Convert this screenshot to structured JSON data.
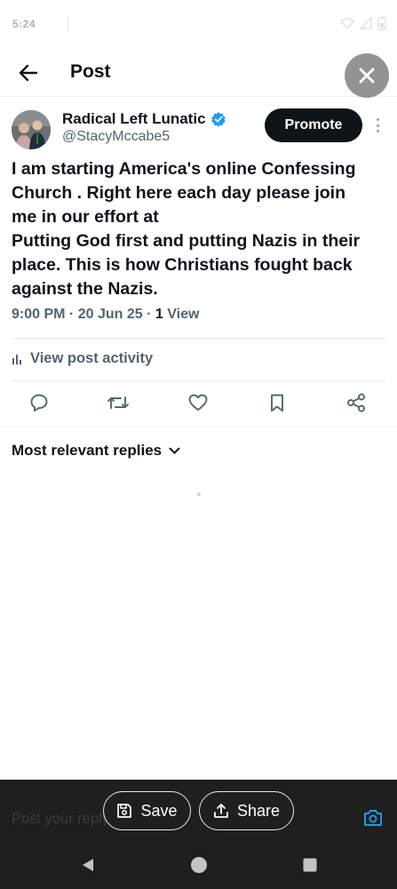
{
  "status_bar": {
    "time": "5:24",
    "icons": [
      "wifi-icon",
      "signal-icon",
      "battery-icon"
    ]
  },
  "header": {
    "title": "Post",
    "back_icon": "arrow-left-icon"
  },
  "overlay": {
    "close_icon": "close-icon"
  },
  "post": {
    "author_name": "Radical Left Lunatic",
    "verified_icon": "verified-badge-icon",
    "handle": "@StacyMccabe5",
    "promote_label": "Promote",
    "text_lines": [
      "I am starting America's online Confessing",
      "Church . Right here each day please join",
      "me in our effort at",
      "Putting God first and putting Nazis in their",
      "place. This is how Christians fought back",
      "against the Nazis."
    ],
    "time": "9:00 PM",
    "date": "20 Jun 25",
    "views_count": "1",
    "views_label": "View",
    "separator": "·"
  },
  "activity": {
    "label": "View post activity",
    "icon": "bar-chart-icon"
  },
  "actions": [
    {
      "name": "reply",
      "icon": "comment-icon"
    },
    {
      "name": "repost",
      "icon": "repost-icon"
    },
    {
      "name": "like",
      "icon": "heart-icon"
    },
    {
      "name": "bookmark",
      "icon": "bookmark-icon"
    },
    {
      "name": "share",
      "icon": "share-icon"
    }
  ],
  "replies": {
    "sort_label": "Most relevant replies",
    "chevron_icon": "chevron-down-icon"
  },
  "bottom": {
    "reply_placeholder": "Post your reply",
    "save_label": "Save",
    "share_label": "Share"
  },
  "colors": {
    "text_primary": "#0f1419",
    "text_secondary": "#536471",
    "verified_blue": "#1d9bf0",
    "promote_bg": "#0f1419",
    "bottom_bar": "#1f1f1f"
  }
}
